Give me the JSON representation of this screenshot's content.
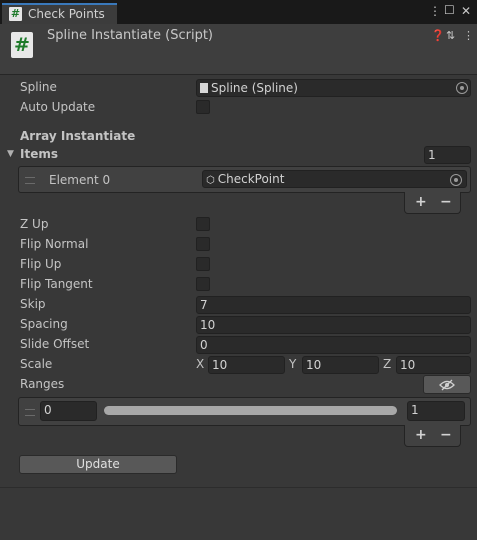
{
  "tab": {
    "icon": "script-hash-icon",
    "label": "Check Points"
  },
  "header": {
    "icon": "script-hash-icon",
    "title": "Spline Instantiate (Script)"
  },
  "fields": {
    "spline": {
      "label": "Spline",
      "value": "Spline (Spline)"
    },
    "auto_update": {
      "label": "Auto Update",
      "checked": false
    },
    "array_heading": "Array Instantiate",
    "items": {
      "label": "Items",
      "count": "1",
      "elements": [
        {
          "label": "Element 0",
          "value": "CheckPoint"
        }
      ]
    },
    "z_up": {
      "label": "Z Up",
      "checked": false
    },
    "flip_normal": {
      "label": "Flip Normal",
      "checked": false
    },
    "flip_up": {
      "label": "Flip Up",
      "checked": false
    },
    "flip_tangent": {
      "label": "Flip Tangent",
      "checked": false
    },
    "skip": {
      "label": "Skip",
      "value": "7"
    },
    "spacing": {
      "label": "Spacing",
      "value": "10"
    },
    "slide_offset": {
      "label": "Slide Offset",
      "value": "0"
    },
    "scale": {
      "label": "Scale",
      "x_label": "X",
      "x": "10",
      "y_label": "Y",
      "y": "10",
      "z_label": "Z",
      "z": "10"
    },
    "ranges": {
      "label": "Ranges",
      "min": "0",
      "max": "1"
    }
  },
  "list_controls": {
    "add": "+",
    "remove": "−"
  },
  "update_button": "Update",
  "colors": {
    "accent": "#3a79bb",
    "script_icon": "#1e7a2a",
    "background": "#383838"
  }
}
